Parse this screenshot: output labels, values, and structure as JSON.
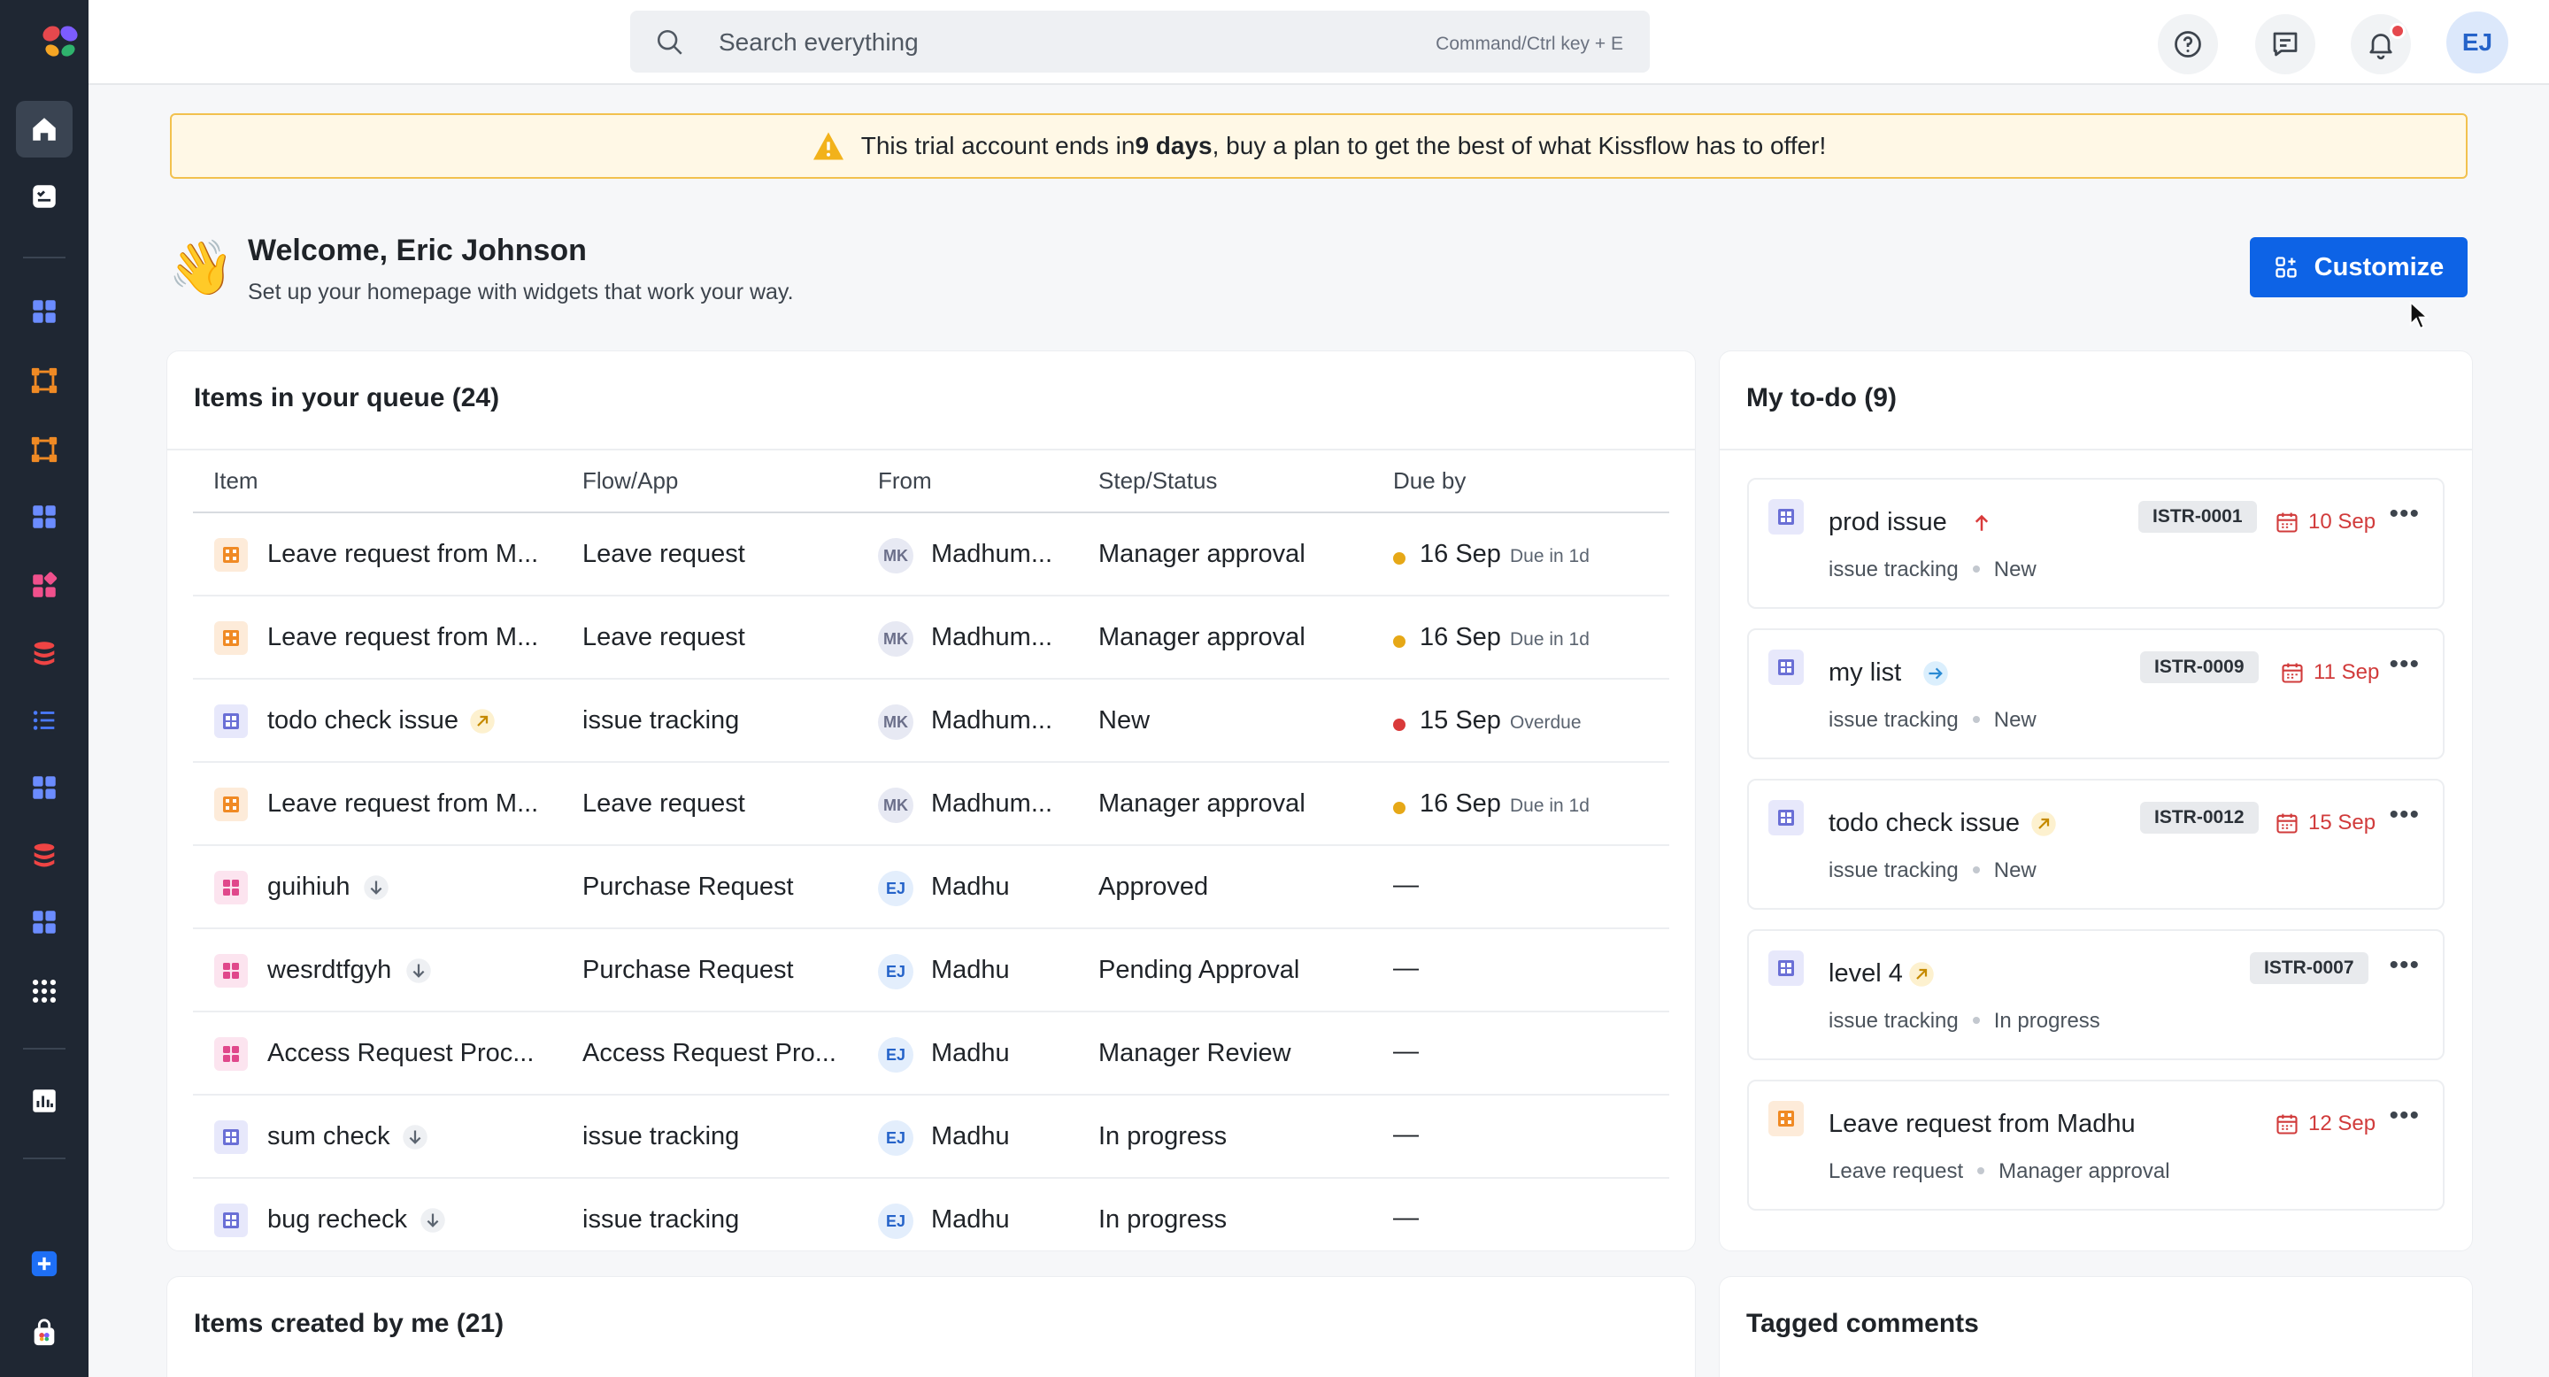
{
  "search": {
    "placeholder": "Search everything",
    "shortcut": "Command/Ctrl key + E"
  },
  "user": {
    "initials": "EJ"
  },
  "banner": {
    "prefix": "This trial account ends in ",
    "days": "9 days",
    "suffix": ", buy a plan to get the best of what Kissflow has to offer!"
  },
  "welcome": {
    "emoji": "👋",
    "title": "Welcome, Eric Johnson",
    "subtitle": "Set up your homepage with widgets that work your way."
  },
  "customize_label": "Customize",
  "queue": {
    "title": "Items in your queue (24)",
    "columns": [
      "Item",
      "Flow/App",
      "From",
      "Step/Status",
      "Due by"
    ],
    "rows": [
      {
        "item": "Leave request from M...",
        "flow": "Leave request",
        "from_initials": "MK",
        "from": "Madhum...",
        "step": "Manager approval",
        "date": "16 Sep",
        "due": "Due in 1d"
      },
      {
        "item": "Leave request from M...",
        "flow": "Leave request",
        "from_initials": "MK",
        "from": "Madhum...",
        "step": "Manager approval",
        "date": "16 Sep",
        "due": "Due in 1d"
      },
      {
        "item": "todo check issue",
        "flow": "issue tracking",
        "from_initials": "MK",
        "from": "Madhum...",
        "step": "New",
        "date": "15 Sep",
        "due": "Overdue"
      },
      {
        "item": "Leave request from M...",
        "flow": "Leave request",
        "from_initials": "MK",
        "from": "Madhum...",
        "step": "Manager approval",
        "date": "16 Sep",
        "due": "Due in 1d"
      },
      {
        "item": "guihiuh",
        "flow": "Purchase Request",
        "from_initials": "EJ",
        "from": "Madhu",
        "step": "Approved",
        "date": "—",
        "due": ""
      },
      {
        "item": "wesrdtfgyh",
        "flow": "Purchase Request",
        "from_initials": "EJ",
        "from": "Madhu",
        "step": "Pending Approval",
        "date": "—",
        "due": ""
      },
      {
        "item": "Access Request Proc...",
        "flow": "Access Request Pro...",
        "from_initials": "EJ",
        "from": "Madhu",
        "step": "Manager Review",
        "date": "—",
        "due": ""
      },
      {
        "item": "sum check",
        "flow": "issue tracking",
        "from_initials": "EJ",
        "from": "Madhu",
        "step": "In progress",
        "date": "—",
        "due": ""
      },
      {
        "item": "bug recheck",
        "flow": "issue tracking",
        "from_initials": "EJ",
        "from": "Madhu",
        "step": "In progress",
        "date": "—",
        "due": ""
      }
    ]
  },
  "todo": {
    "title": "My to-do (9)",
    "items": [
      {
        "title": "prod issue",
        "app": "issue tracking",
        "status": "New",
        "id": "ISTR-0001",
        "date": "10 Sep"
      },
      {
        "title": "my list",
        "app": "issue tracking",
        "status": "New",
        "id": "ISTR-0009",
        "date": "11 Sep"
      },
      {
        "title": "todo check issue",
        "app": "issue tracking",
        "status": "New",
        "id": "ISTR-0012",
        "date": "15 Sep"
      },
      {
        "title": "level 4",
        "app": "issue tracking",
        "status": "In progress",
        "id": "ISTR-0007",
        "date": ""
      },
      {
        "title": "Leave request from Madhu",
        "app": "Leave request",
        "status": "Manager approval",
        "id": "",
        "date": "12 Sep"
      }
    ]
  },
  "created": {
    "title": "Items created by me (21)"
  },
  "tagged": {
    "title": "Tagged comments"
  },
  "colors": {
    "accent": "#0d63e6",
    "sidebar_bg": "#1f2733",
    "due_soon": "#e6a817",
    "overdue": "#d93a3a",
    "date_red": "#d13b3b"
  }
}
